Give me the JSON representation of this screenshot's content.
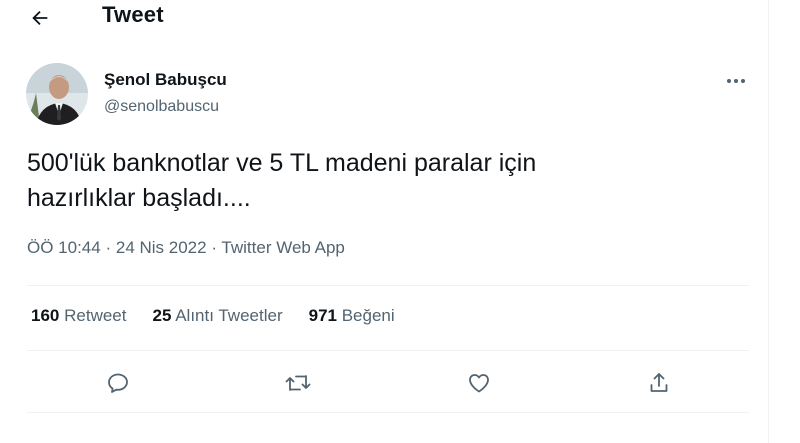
{
  "header": {
    "title": "Tweet",
    "back_icon": "arrow-left-icon"
  },
  "tweet": {
    "author_name": "Şenol Babuşcu",
    "author_handle": "@senolbabuscu",
    "more_icon": "more-horizontal-icon",
    "text_line1": "500'lük banknotlar ve 5 TL madeni paralar için",
    "text_line2": "hazırlıklar başladı....",
    "time": "ÖÖ 10:44",
    "date": "24 Nis 2022",
    "source": "Twitter Web App",
    "separator": "·"
  },
  "stats": {
    "retweets_count": "160",
    "retweets_label": "Retweet",
    "quotes_count": "25",
    "quotes_label": "Alıntı Tweetler",
    "likes_count": "971",
    "likes_label": "Beğeni"
  },
  "actions": {
    "reply_icon": "reply-icon",
    "retweet_icon": "retweet-icon",
    "like_icon": "heart-icon",
    "share_icon": "share-icon"
  },
  "colors": {
    "text": "#0f1419",
    "secondary": "#536471",
    "divider": "#eff3f4"
  }
}
